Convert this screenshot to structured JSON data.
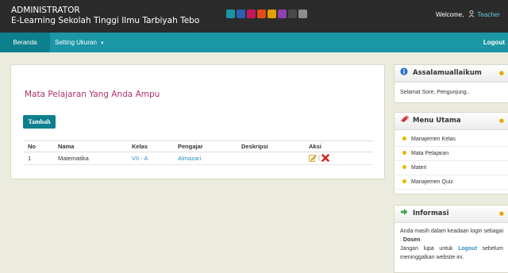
{
  "header": {
    "title_line1": "ADMINISTRATOR",
    "title_line2": "E-Learning Sekolah Tinggi Ilmu Tarbiyah Tebo",
    "theme_colors": [
      "#1b96a6",
      "#2d5fb3",
      "#c2185b",
      "#e64a19",
      "#e0a100",
      "#8e3fb0",
      "#4a4a4a",
      "#8d8d8d"
    ],
    "welcome_label": "Welcome,",
    "user_icon": "user-icon",
    "username": "Teacher"
  },
  "nav": {
    "home": "Beranda",
    "setting": "Setting Ukuran",
    "logout": "Logout"
  },
  "main": {
    "title": "Mata Pelajaran Yang Anda Ampu",
    "add_button": "Tambah",
    "table": {
      "headers": [
        "No",
        "Nama",
        "Kelas",
        "Pengajar",
        "Deskripsi",
        "Aksi"
      ],
      "rows": [
        {
          "no": "1",
          "nama": "Matematika",
          "kelas": "VII - A",
          "pengajar": "Almazari",
          "deskripsi": ""
        }
      ],
      "action_separator": "|",
      "edit_icon": "edit-icon",
      "delete_icon": "delete-icon"
    }
  },
  "sidebar": {
    "greeting": {
      "title": "Assalamuallaikum",
      "text": "Selamat Sore, Pengunjung..",
      "icon": "info-icon"
    },
    "menu": {
      "title": "Menu Utama",
      "icon": "eraser-icon",
      "items": [
        "Manajemen Kelas",
        "Mata Pelajaran",
        "Materi",
        "Manajemen Quiz"
      ]
    },
    "info": {
      "title": "Informasi",
      "icon": "arrow-right-icon",
      "line1": "Anda masih dalam keadaan login sebagai :",
      "role": "Dosen",
      "line2a": "Jangan lupa untuk",
      "logout_link": "Logout",
      "line2b": "sebelum meninggalkan website ini."
    }
  },
  "colors": {
    "topbar": "#2b2b2b",
    "navbar": "#1b96a6",
    "accent_title": "#b0306a",
    "link": "#2f8fc5"
  }
}
